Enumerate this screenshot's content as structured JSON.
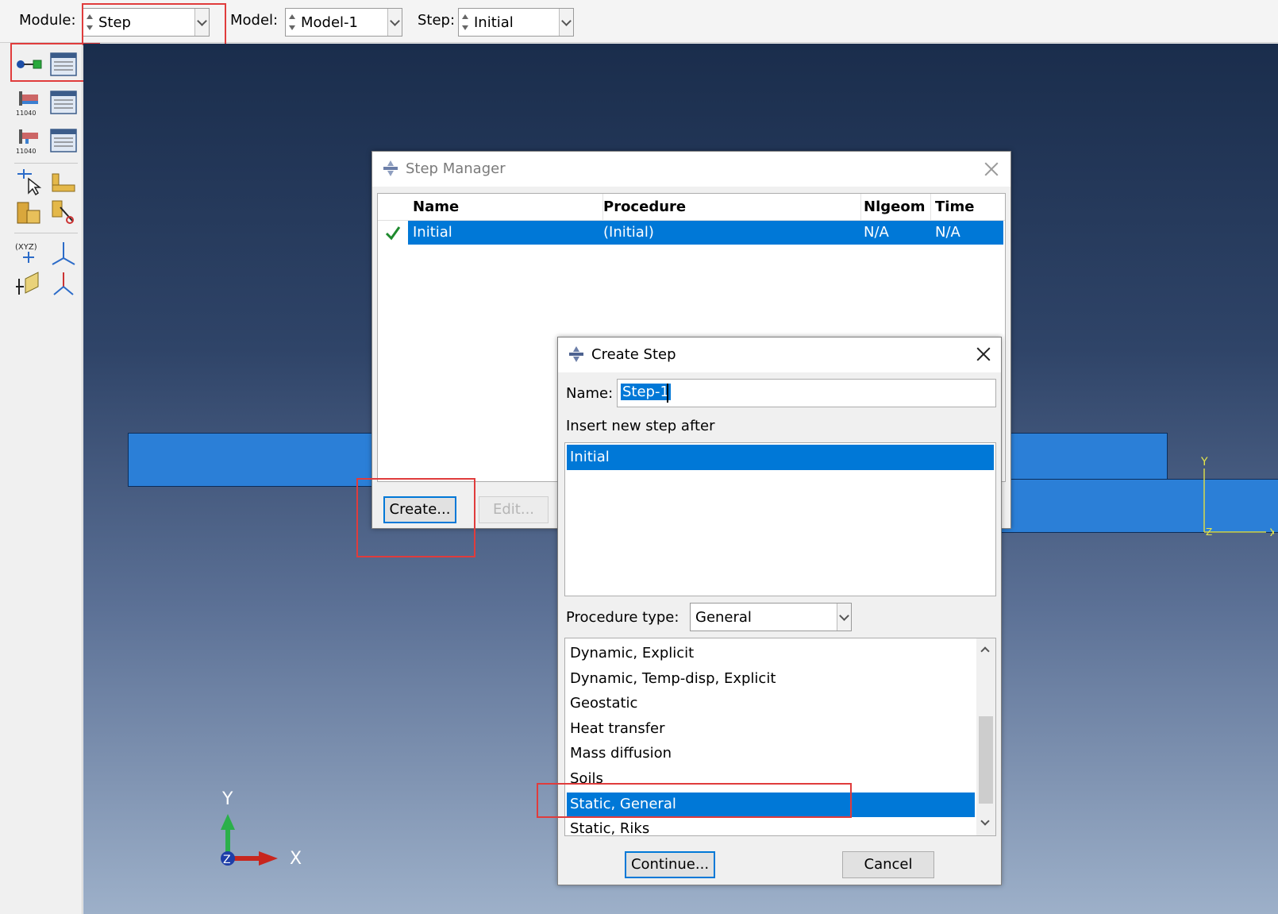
{
  "context_bar": {
    "module_label": "Module:",
    "module_value": "Step",
    "model_label": "Model:",
    "model_value": "Model-1",
    "step_label": "Step:",
    "step_value": "Initial"
  },
  "step_manager": {
    "title": "Step Manager",
    "columns": [
      "Name",
      "Procedure",
      "Nlgeom",
      "Time"
    ],
    "rows": [
      {
        "name": "Initial",
        "procedure": "(Initial)",
        "nlgeom": "N/A",
        "time": "N/A"
      }
    ],
    "create_label": "Create...",
    "edit_label": "Edit..."
  },
  "create_step": {
    "title": "Create Step",
    "name_label": "Name:",
    "name_value": "Step-1",
    "insert_label": "Insert new step after",
    "insert_items": [
      "Initial"
    ],
    "procedure_type_label": "Procedure type:",
    "procedure_type_value": "General",
    "procedures": [
      "Dynamic, Explicit",
      "Dynamic, Temp-disp, Explicit",
      "Geostatic",
      "Heat transfer",
      "Mass diffusion",
      "Soils",
      "Static, General",
      "Static, Riks"
    ],
    "selected_procedure_index": 6,
    "continue_label": "Continue...",
    "cancel_label": "Cancel"
  },
  "triad": {
    "y": "Y",
    "x": "X",
    "z": "Z"
  },
  "mini_triad": {
    "y": "Y",
    "x": "X",
    "z": "Z"
  },
  "toolbox_labels": {
    "xyz": "(XYZ)"
  },
  "colors": {
    "selection": "#0078d7",
    "highlight_box": "#e03c3c",
    "part": "#2b7fd7"
  }
}
